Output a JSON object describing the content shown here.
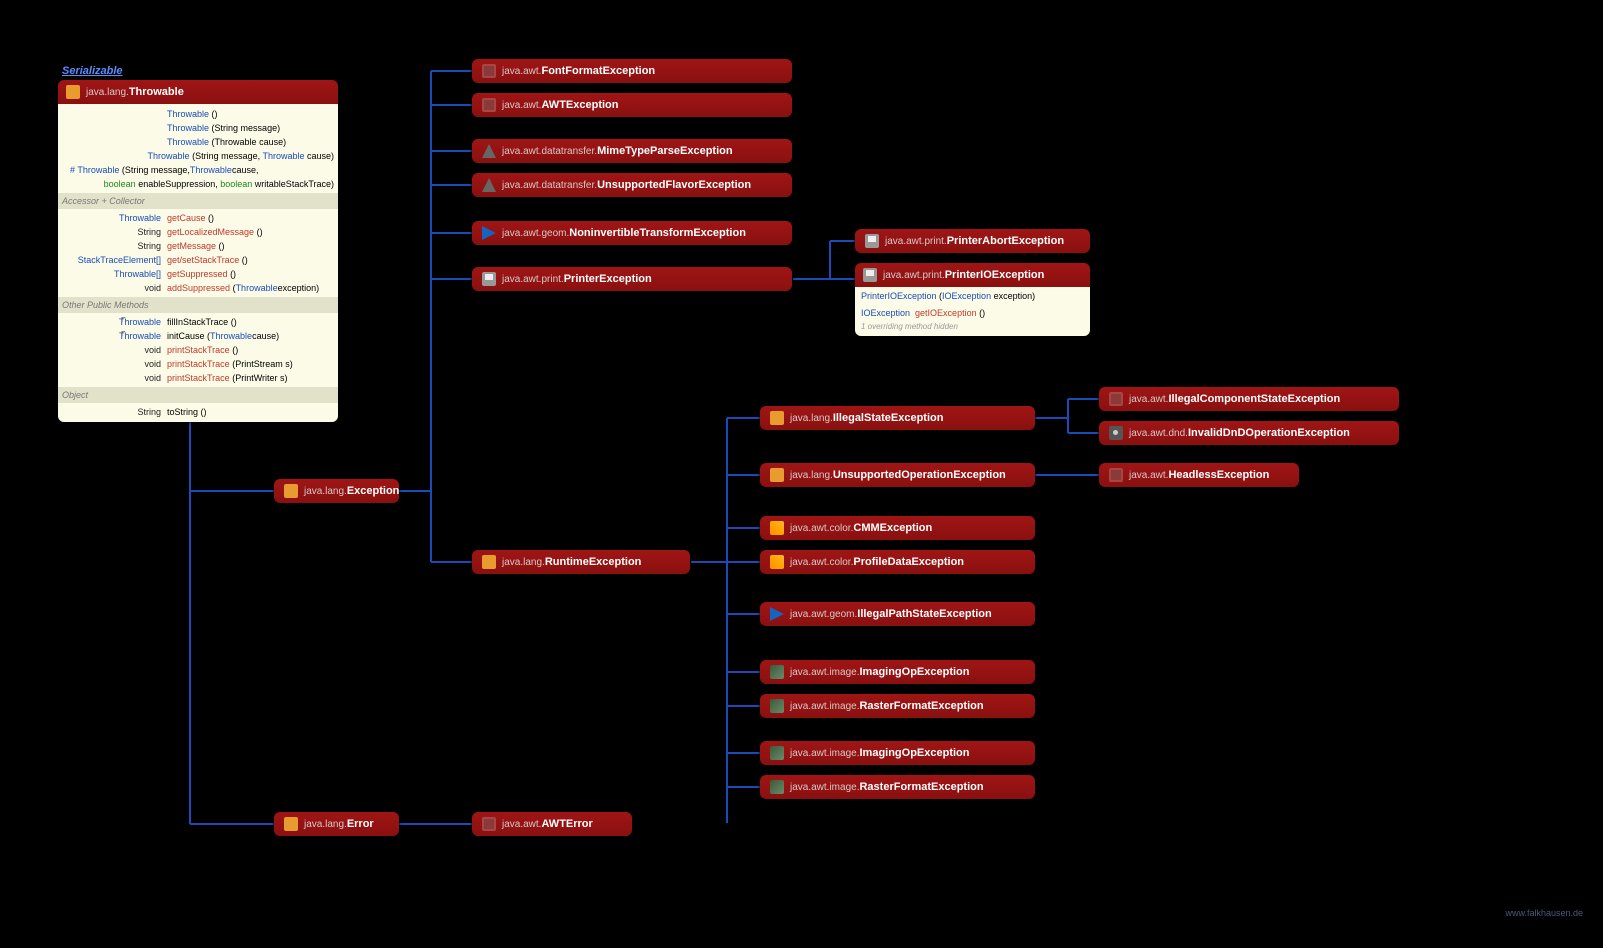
{
  "serializable": "Serializable",
  "throwable": {
    "pkg": "java.lang.",
    "name": "Throwable",
    "ctors": [
      {
        "sig": "Throwable",
        "params": "()"
      },
      {
        "sig": "Throwable",
        "params": "(String message)"
      },
      {
        "sig": "Throwable",
        "params": "(Throwable cause)"
      },
      {
        "sig": "Throwable",
        "params": "(String message, Throwable cause)"
      },
      {
        "sig": "# Throwable",
        "params": "(String message, Throwable cause,",
        "line2": "boolean enableSuppression, boolean writableStackTrace)"
      }
    ],
    "sec1": "Accessor + Collector",
    "acc": [
      {
        "ret": "Throwable",
        "name": "getCause",
        "p": "()"
      },
      {
        "ret": "String",
        "name": "getLocalizedMessage",
        "p": "()"
      },
      {
        "ret": "String",
        "name": "getMessage",
        "p": "()"
      },
      {
        "ret": "StackTraceElement[]",
        "name": "get/setStackTrace",
        "p": "()"
      },
      {
        "ret": "Throwable[]",
        "name": "getSuppressed",
        "p": "()"
      },
      {
        "ret": "void",
        "name": "addSuppressed",
        "p": "(Throwable exception)"
      }
    ],
    "sec2": "Other Public Methods",
    "other": [
      {
        "ret": "Throwable",
        "name": "fillInStackTrace",
        "p": "()"
      },
      {
        "ret": "Throwable",
        "name": "initCause",
        "p": "(Throwable cause)"
      },
      {
        "ret": "void",
        "name": "printStackTrace",
        "p": "()"
      },
      {
        "ret": "void",
        "name": "printStackTrace",
        "p": "(PrintStream s)"
      },
      {
        "ret": "void",
        "name": "printStackTrace",
        "p": "(PrintWriter s)"
      }
    ],
    "sec3": "Object",
    "obj": [
      {
        "ret": "String",
        "name": "toString",
        "p": "()"
      }
    ]
  },
  "nodes": {
    "exception": {
      "pkg": "java.lang.",
      "name": "Exception"
    },
    "error": {
      "pkg": "java.lang.",
      "name": "Error"
    },
    "awterror": {
      "pkg": "java.awt.",
      "name": "AWTError"
    },
    "fontformat": {
      "pkg": "java.awt.",
      "name": "FontFormatException"
    },
    "awtexception": {
      "pkg": "java.awt.",
      "name": "AWTException"
    },
    "mimetype": {
      "pkg": "java.awt.datatransfer.",
      "name": "MimeTypeParseException"
    },
    "unsflavor": {
      "pkg": "java.awt.datatransfer.",
      "name": "UnsupportedFlavorException"
    },
    "noninv": {
      "pkg": "java.awt.geom.",
      "name": "NoninvertibleTransformException"
    },
    "printerex": {
      "pkg": "java.awt.print.",
      "name": "PrinterException"
    },
    "runtime": {
      "pkg": "java.lang.",
      "name": "RuntimeException"
    },
    "printerabort": {
      "pkg": "java.awt.print.",
      "name": "PrinterAbortException"
    },
    "printerio": {
      "pkg": "java.awt.print.",
      "name": "PrinterIOException",
      "ctor": "PrinterIOException (IOException exception)",
      "m_ret": "IOException",
      "m_name": "getIOException",
      "m_p": "()",
      "note": "1 overriding method hidden"
    },
    "illegalstate": {
      "pkg": "java.lang.",
      "name": "IllegalStateException"
    },
    "unsupop": {
      "pkg": "java.lang.",
      "name": "UnsupportedOperationException"
    },
    "cmm": {
      "pkg": "java.awt.color.",
      "name": "CMMException"
    },
    "profiledata": {
      "pkg": "java.awt.color.",
      "name": "ProfileDataException"
    },
    "illegalpath": {
      "pkg": "java.awt.geom.",
      "name": "IllegalPathStateException"
    },
    "imagingop1": {
      "pkg": "java.awt.image.",
      "name": "ImagingOpException"
    },
    "rasterformat1": {
      "pkg": "java.awt.image.",
      "name": "RasterFormatException"
    },
    "imagingop2": {
      "pkg": "java.awt.image.",
      "name": "ImagingOpException"
    },
    "rasterformat2": {
      "pkg": "java.awt.image.",
      "name": "RasterFormatException"
    },
    "illegalcomp": {
      "pkg": "java.awt.",
      "name": "IllegalComponentStateException"
    },
    "invaliddnd": {
      "pkg": "java.awt.dnd.",
      "name": "InvalidDnDOperationException"
    },
    "headless": {
      "pkg": "java.awt.",
      "name": "HeadlessException"
    }
  },
  "watermark": "www.falkhausen.de"
}
